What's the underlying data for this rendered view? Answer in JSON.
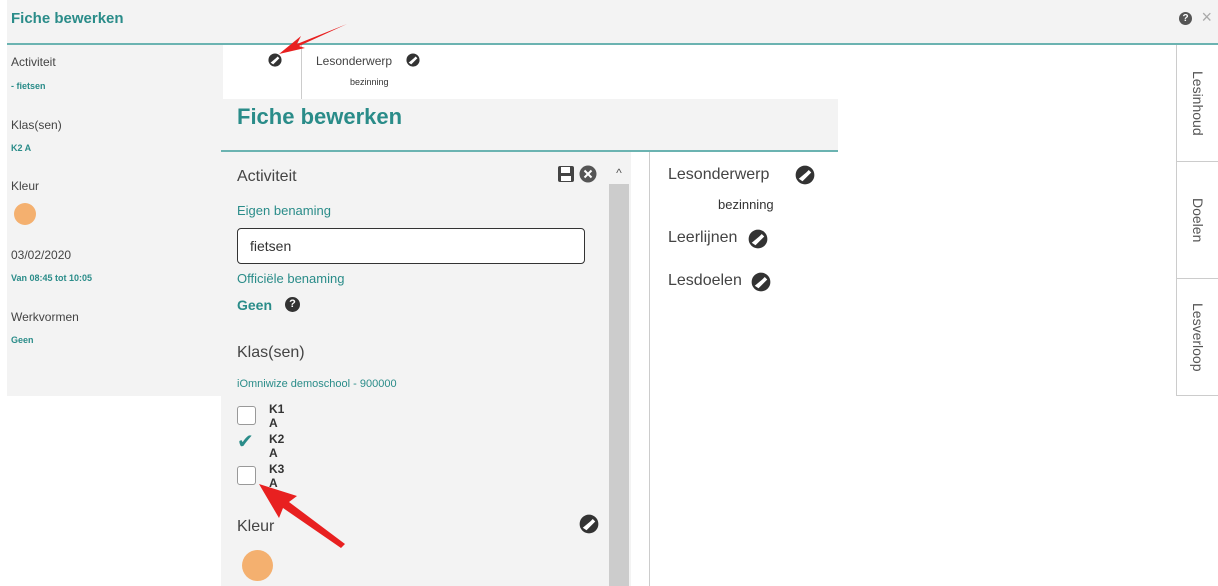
{
  "background": {
    "title": "Fiche bewerken",
    "help_glyph": "?",
    "close_glyph": "×",
    "left": {
      "activiteit_label": "Activiteit",
      "activiteit_value": "- fietsen",
      "klassen_label": "Klas(sen)",
      "klassen_value": "K2 A",
      "kleur_label": "Kleur",
      "date": "03/02/2020",
      "time": "Van 08:45 tot 10:05",
      "werkvormen_label": "Werkvormen",
      "werkvormen_value": "Geen"
    },
    "lesonderwerp_label": "Lesonderwerp",
    "lesonderwerp_value": "bezinning"
  },
  "tabs": [
    "Lesinhoud",
    "Doelen",
    "Lesverloop"
  ],
  "foreground": {
    "title": "Fiche bewerken",
    "activiteit_label": "Activiteit",
    "eigen_benaming_label": "Eigen benaming",
    "eigen_benaming_value": "fietsen",
    "officiele_benaming_label": "Officiële benaming",
    "officiele_benaming_value": "Geen",
    "help_glyph": "?",
    "klassen_label": "Klas(sen)",
    "school": "iOmniwize demoschool - 900000",
    "classes": [
      {
        "label": "K1 A",
        "checked": false
      },
      {
        "label": "K2 A",
        "checked": true
      },
      {
        "label": "K3 A",
        "checked": false
      }
    ],
    "kleur_label": "Kleur",
    "scroll_up_glyph": "^",
    "lesonderwerp_label": "Lesonderwerp",
    "lesonderwerp_value": "bezinning",
    "leerlijnen_label": "Leerlijnen",
    "lesdoelen_label": "Lesdoelen"
  },
  "colors": {
    "accent": "#2a8c89",
    "kleur": "#f4b06f",
    "arrow": "#e82020"
  }
}
